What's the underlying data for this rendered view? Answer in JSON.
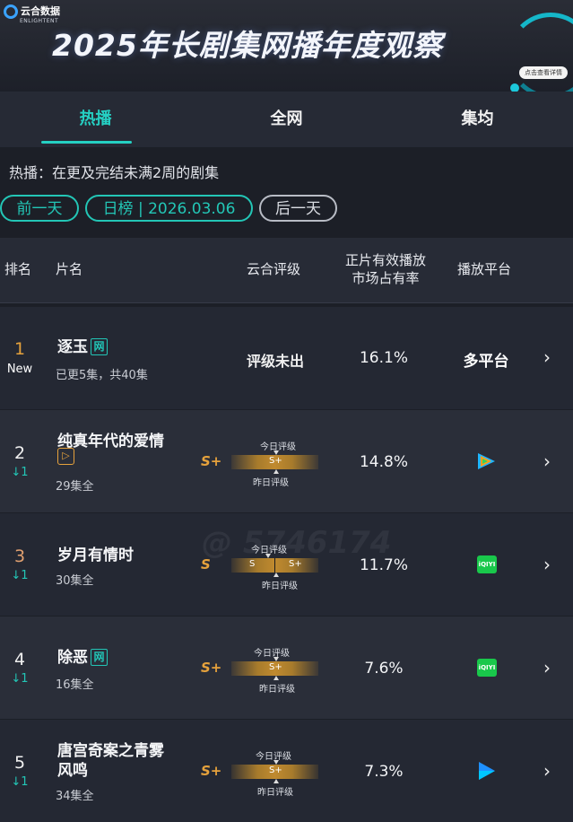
{
  "banner": {
    "logo_text": "云合数据",
    "logo_sub": "ENLIGHTENT",
    "title": "2025年长剧集网播年度观察",
    "detail_link": "点击查看详情"
  },
  "tabs": [
    {
      "label": "热播",
      "active": true
    },
    {
      "label": "全网",
      "active": false
    },
    {
      "label": "集均",
      "active": false
    }
  ],
  "description": "热播：在更及完结未满2周的剧集",
  "day_nav": {
    "prev": "前一天",
    "current": "日榜 | 2026.03.06",
    "next": "后一天"
  },
  "table_headers": {
    "rank": "排名",
    "name": "片名",
    "rating": "云合评级",
    "share_line1": "正片有效播放",
    "share_line2": "市场占有率",
    "platform": "播放平台"
  },
  "rating_labels": {
    "today": "今日评级",
    "yesterday": "昨日评级"
  },
  "rows": [
    {
      "rank": "1",
      "change": "New",
      "title": "逐玉",
      "badge": "网",
      "subtitle": "已更5集，共40集",
      "rating": "评级未出",
      "share": "16.1%",
      "platform": "多平台",
      "platform_icon": "multi-platform"
    },
    {
      "rank": "2",
      "change": "↓1",
      "title": "纯真年代的爱情",
      "subtitle": "29集全",
      "grade": "S+",
      "bar": [
        "S+"
      ],
      "share": "14.8%",
      "platform_icon": "tencent-video-icon"
    },
    {
      "rank": "3",
      "change": "↓1",
      "title": "岁月有情时",
      "subtitle": "30集全",
      "grade": "S",
      "bar": [
        "S",
        "S+"
      ],
      "share": "11.7%",
      "platform_icon": "iqiyi-icon"
    },
    {
      "rank": "4",
      "change": "↓1",
      "title": "除恶",
      "badge": "网",
      "subtitle": "16集全",
      "grade": "S+",
      "bar": [
        "S+"
      ],
      "share": "7.6%",
      "platform_icon": "iqiyi-icon"
    },
    {
      "rank": "5",
      "change": "↓1",
      "title_line1": "唐宫奇案之青雾",
      "title_line2": "风鸣",
      "subtitle": "34集全",
      "grade": "S+",
      "bar": [
        "S+"
      ],
      "share": "7.3%",
      "platform_icon": "youku-icon"
    }
  ],
  "colors": {
    "accent": "#25d0c3",
    "gold": "#e6a23c",
    "rank3": "#e0a070",
    "iqiyi": "#19c84b"
  },
  "watermark": "@ 5746174"
}
